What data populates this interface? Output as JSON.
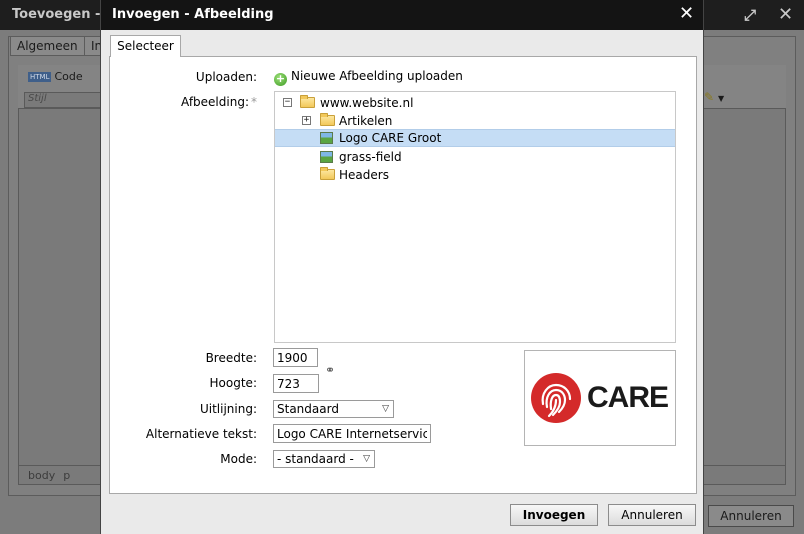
{
  "background": {
    "title": "Toevoegen - A",
    "tabs": [
      "Algemeen",
      "In"
    ],
    "code_button": "Code",
    "html_badge": "HTML",
    "style_placeholder": "Stijl",
    "status_path": [
      "body",
      "p"
    ],
    "cancel_label": "Annuleren"
  },
  "dialog": {
    "title": "Invoegen - Afbeelding",
    "tab": "Selecteer",
    "labels": {
      "uploaden": "Uploaden:",
      "afbeelding": "Afbeelding:",
      "required_mark": "*",
      "breedte": "Breedte:",
      "hoogte": "Hoogte:",
      "uitlijning": "Uitlijning:",
      "alt": "Alternatieve tekst:",
      "mode": "Mode:"
    },
    "upload_link": "Nieuwe Afbeelding uploaden",
    "tree": {
      "root": "www.website.nl",
      "items": [
        "Artikelen",
        "Logo CARE Groot",
        "grass-field",
        "Headers"
      ],
      "selected": "Logo CARE Groot"
    },
    "fields": {
      "breedte": "1900",
      "hoogte": "723",
      "uitlijning": "Standaard",
      "alt": "Logo CARE Internetservices",
      "mode": "- standaard -"
    },
    "preview": {
      "logo_text": "CARE",
      "logo_color": "#d42a2a"
    },
    "buttons": {
      "insert": "Invoegen",
      "cancel": "Annuleren"
    }
  }
}
